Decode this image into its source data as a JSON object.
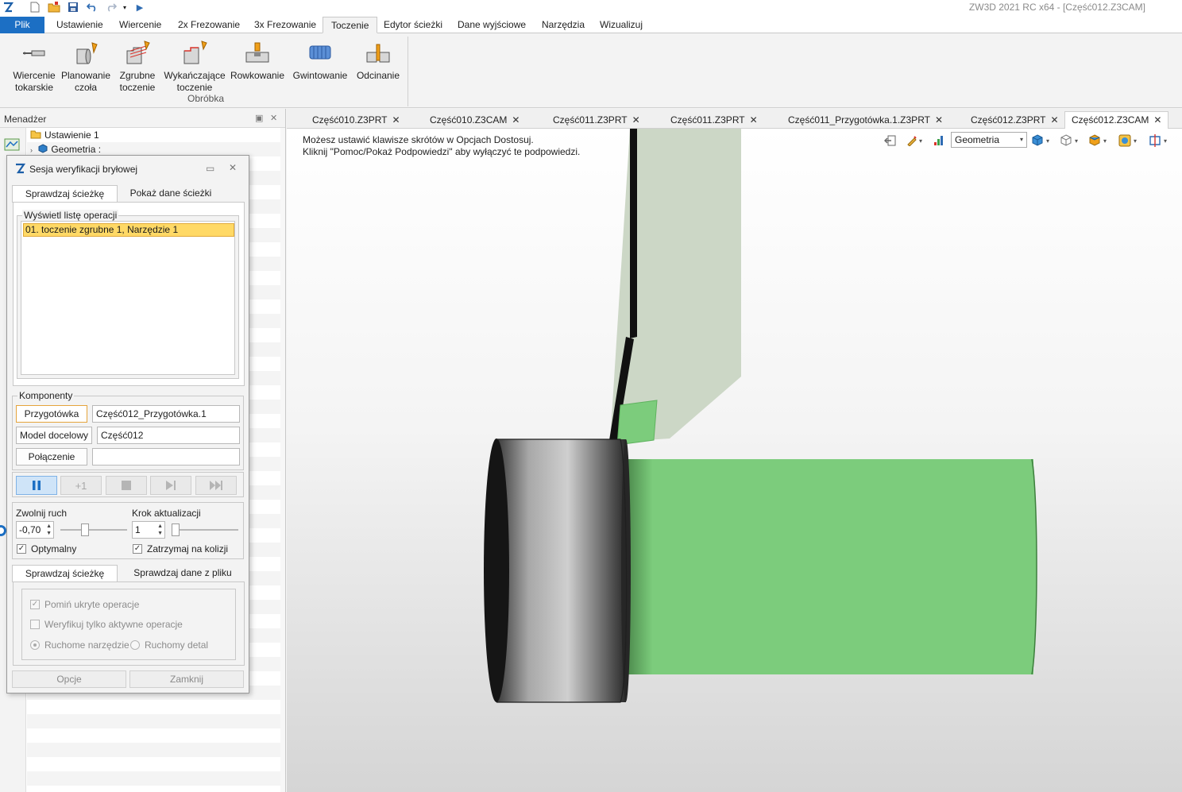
{
  "app": {
    "title": "ZW3D 2021 RC x64 - [Część012.Z3CAM]"
  },
  "menu": {
    "file": "Plik",
    "tabs": [
      "Ustawienie",
      "Wiercenie",
      "2x Frezowanie",
      "3x Frezowanie",
      "Toczenie",
      "Edytor ścieżki",
      "Dane wyjściowe",
      "Narzędzia",
      "Wizualizuj"
    ],
    "active": "Toczenie"
  },
  "ribbon": {
    "buttons": [
      {
        "line1": "Wiercenie",
        "line2": "tokarskie",
        "icon": "lathe-drill-icon"
      },
      {
        "line1": "Planowanie",
        "line2": "czoła",
        "icon": "facing-icon"
      },
      {
        "line1": "Zgrubne",
        "line2": "toczenie",
        "icon": "rough-turning-icon"
      },
      {
        "line1": "Wykańczające",
        "line2": "toczenie",
        "icon": "finish-turning-icon"
      },
      {
        "line1": "Rowkowanie",
        "line2": "",
        "icon": "grooving-icon"
      },
      {
        "line1": "Gwintowanie",
        "line2": "",
        "icon": "threading-icon"
      },
      {
        "line1": "Odcinanie",
        "line2": "",
        "icon": "cutoff-icon"
      }
    ],
    "group_label": "Obróbka"
  },
  "manager": {
    "title": "Menadżer",
    "tree": [
      {
        "label": "Ustawienie 1",
        "icon": "folder-icon"
      },
      {
        "label": "Geometria :",
        "icon": "geometry-cube-icon"
      }
    ]
  },
  "dialog": {
    "title": "Sesja weryfikacji bryłowej",
    "tabs_top": [
      "Sprawdzaj ścieżkę",
      "Pokaż dane ścieżki"
    ],
    "operations_group": "Wyświetl listę operacji",
    "operations": [
      "01. toczenie zgrubne 1, Narzędzie 1"
    ],
    "components_group": "Komponenty",
    "components": [
      {
        "button": "Przygotówka",
        "value": "Część012_Przygotówka.1"
      },
      {
        "button": "Model docelowy",
        "value": "Część012"
      },
      {
        "button": "Połączenie",
        "value": ""
      }
    ],
    "playback": [
      "pause-icon",
      "step-plus-one-icon",
      "stop-icon",
      "step-forward-icon",
      "fast-forward-icon"
    ],
    "playback_text": {
      "step": "+1"
    },
    "slow_label": "Zwolnij ruch",
    "slow_value": "-0,70",
    "slow_level": 0.35,
    "step_label": "Krok aktualizacji",
    "step_value": "1",
    "step_level": 0.0,
    "optimal_label": "Optymalny",
    "optimal_checked": true,
    "stop_collision_label": "Zatrzymaj na kolizji",
    "stop_collision_checked": true,
    "tabs_bottom": [
      "Sprawdzaj ścieżkę",
      "Sprawdzaj dane z pliku"
    ],
    "skip_hidden_label": "Pomiń ukryte operacje",
    "skip_hidden_checked": true,
    "verify_active_label": "Weryfikuj tylko aktywne operacje",
    "verify_active_checked": false,
    "moving_tool_label": "Ruchome narzędzie",
    "moving_part_label": "Ruchomy detal",
    "options_button": "Opcje",
    "close_button": "Zamknij"
  },
  "doc_tabs": [
    {
      "label": "Część010.Z3PRT",
      "active": false
    },
    {
      "label": "Część010.Z3CAM",
      "active": false
    },
    {
      "label": "Część011.Z3PRT",
      "active": false
    },
    {
      "label": "Część011.Z3PRT",
      "active": false
    },
    {
      "label": "Część011_Przygotówka.1.Z3PRT",
      "active": false
    },
    {
      "label": "Część012.Z3PRT",
      "active": false
    },
    {
      "label": "Część012.Z3CAM",
      "active": true
    }
  ],
  "viewport": {
    "hint_line1": "Możesz ustawić klawisze skrótów w Opcjach Dostosuj.",
    "hint_line2": "Kliknij \"Pomoc/Pokaż Podpowiedzi\" aby wyłączyć te podpowiedzi.",
    "filter_value": "Geometria"
  },
  "colors": {
    "accent": "#1c6fc4",
    "selection": "#ffd966",
    "part_green": "#7ccc7c",
    "stock_grey": "#9a9a9a",
    "tool_holder": "#c9d5c3"
  }
}
